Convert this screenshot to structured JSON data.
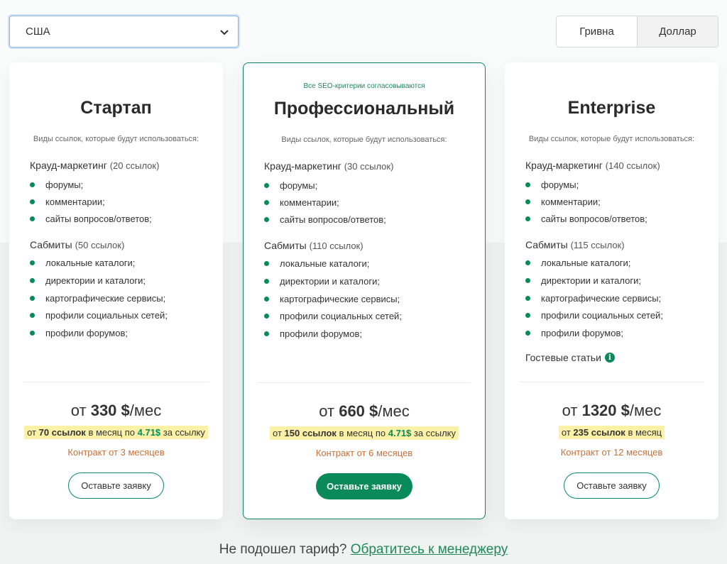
{
  "country_select": {
    "value": "США"
  },
  "currency": {
    "options": [
      "Гривна",
      "Доллар"
    ],
    "selected": "Доллар"
  },
  "colors": {
    "accent": "#0a8a5a",
    "highlight": "#fbf2a8",
    "contract": "#c8713a"
  },
  "plans": [
    {
      "name": "Стартап",
      "subtitle": "Виды ссылок, которые будут использоваться:",
      "crowd": {
        "label": "Крауд-маркетинг",
        "count": "(20 ссылок)",
        "items": [
          "форумы;",
          "комментарии;",
          "сайты вопросов/ответов;"
        ]
      },
      "submits": {
        "label": "Сабмиты",
        "count": "(50 ссылок)",
        "items": [
          "локальные каталоги;",
          "директории и каталоги;",
          "картографические сервисы;",
          "профили социальных сетей;",
          "профили форумов;"
        ]
      },
      "price": {
        "prefix": "от",
        "amount": "330 $",
        "suffix": "/мес"
      },
      "perlink": {
        "pre": "от",
        "links": "70 ссылок",
        "mid": "в месяц по",
        "rate": "4.71$",
        "post": "за ссылку"
      },
      "contract": "Контракт от 3 месяцев",
      "cta": "Оставьте заявку"
    },
    {
      "name": "Профессиональный",
      "note": "Все SEO-критерии согласовываются",
      "subtitle": "Виды ссылок, которые будут использоваться:",
      "crowd": {
        "label": "Крауд-маркетинг",
        "count": "(30 ссылок)",
        "items": [
          "форумы;",
          "комментарии;",
          "сайты вопросов/ответов;"
        ]
      },
      "submits": {
        "label": "Сабмиты",
        "count": "(110 ссылок)",
        "items": [
          "локальные каталоги;",
          "директории и каталоги;",
          "картографические сервисы;",
          "профили социальных сетей;",
          "профили форумов;"
        ]
      },
      "price": {
        "prefix": "от",
        "amount": "660 $",
        "suffix": "/мес"
      },
      "perlink": {
        "pre": "от",
        "links": "150 ссылок",
        "mid": "в месяц по",
        "rate": "4.71$",
        "post": "за ссылку"
      },
      "contract": "Контракт от 6 месяцев",
      "cta": "Оставьте заявку"
    },
    {
      "name": "Enterprise",
      "subtitle": "Виды ссылок, которые будут использоваться:",
      "crowd": {
        "label": "Крауд-маркетинг",
        "count": "(140 ссылок)",
        "items": [
          "форумы;",
          "комментарии;",
          "сайты вопросов/ответов;"
        ]
      },
      "submits": {
        "label": "Сабмиты",
        "count": "(115 ссылок)",
        "items": [
          "локальные каталоги;",
          "директории и каталоги;",
          "картографические сервисы;",
          "профили социальных сетей;",
          "профили форумов;"
        ]
      },
      "guest": "Гостевые статьи",
      "guest_icon": "i",
      "price": {
        "prefix": "от",
        "amount": "1320 $",
        "suffix": "/мес"
      },
      "perlink": {
        "pre": "от",
        "links": "235 ссылок",
        "mid": "в месяц"
      },
      "contract": "Контракт от 12 месяцев",
      "cta": "Оставьте заявку"
    }
  ],
  "footer": {
    "text": "Не подошел тариф?",
    "link": "Обратитесь к менеджеру"
  }
}
